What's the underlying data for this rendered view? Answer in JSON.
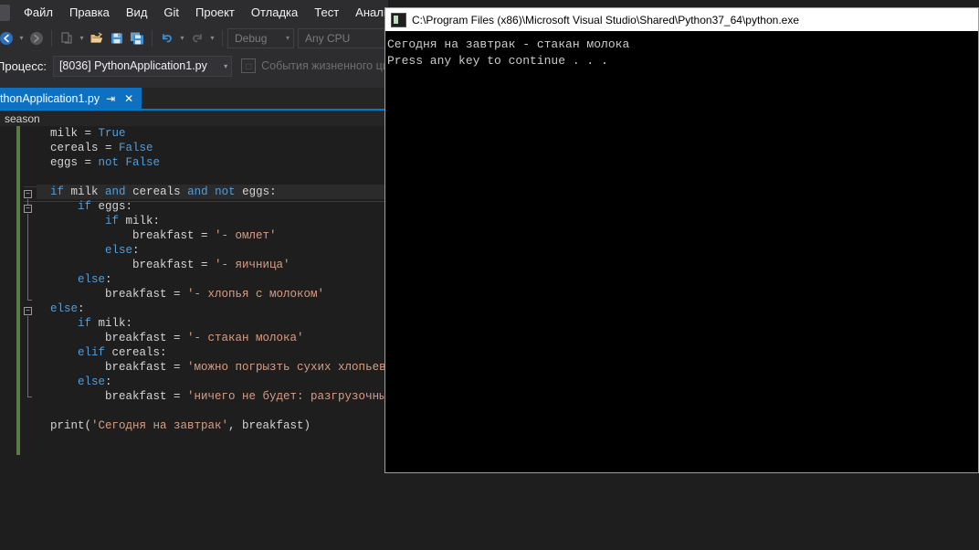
{
  "ide": {
    "menu": [
      {
        "label": "Файл"
      },
      {
        "label": "Правка"
      },
      {
        "label": "Вид"
      },
      {
        "label": "Git"
      },
      {
        "label": "Проект"
      },
      {
        "label": "Отладка"
      },
      {
        "label": "Тест"
      },
      {
        "label": "Анализ"
      }
    ],
    "toolbar": {
      "nav_back_icon": "arrow-left-circle-icon",
      "nav_forward_icon": "arrow-right-circle-icon",
      "new_item_icon": "new-item-icon",
      "open_file_icon": "open-folder-icon",
      "save_icon": "save-icon",
      "save_all_icon": "save-all-icon",
      "undo_icon": "undo-icon",
      "redo_icon": "redo-icon",
      "config_value": "Debug",
      "platform_value": "Any CPU"
    },
    "debug_bar": {
      "process_label": "Процесс:",
      "process_value": "[8036] PythonApplication1.py",
      "lifecycle_label": "События жизненного ци",
      "lifecycle_icon": "lifecycle-events-icon"
    },
    "tab": {
      "label": "thonApplication1.py",
      "pin_icon": "pin-icon",
      "close_icon": "close-icon"
    },
    "breadcrumb": {
      "text": "season"
    },
    "accent_color": "#007acc",
    "tab_active_color": "#0e70c0",
    "change_bar_color": "#5a7b45"
  },
  "code": {
    "lines": [
      [
        {
          "t": "  milk ",
          "c": "pl"
        },
        {
          "t": "= ",
          "c": "pl"
        },
        {
          "t": "True",
          "c": "kw"
        }
      ],
      [
        {
          "t": "  cereals ",
          "c": "pl"
        },
        {
          "t": "= ",
          "c": "pl"
        },
        {
          "t": "False",
          "c": "kw"
        }
      ],
      [
        {
          "t": "  eggs ",
          "c": "pl"
        },
        {
          "t": "= ",
          "c": "pl"
        },
        {
          "t": "not ",
          "c": "kw"
        },
        {
          "t": "False",
          "c": "kw"
        }
      ],
      [
        {
          "t": "",
          "c": "pl"
        }
      ],
      [
        {
          "t": "  ",
          "c": "pl"
        },
        {
          "t": "if ",
          "c": "kw"
        },
        {
          "t": "milk ",
          "c": "pl"
        },
        {
          "t": "and ",
          "c": "kw"
        },
        {
          "t": "cereals ",
          "c": "pl"
        },
        {
          "t": "and ",
          "c": "kw"
        },
        {
          "t": "not ",
          "c": "kw"
        },
        {
          "t": "eggs:",
          "c": "pl"
        }
      ],
      [
        {
          "t": "      ",
          "c": "pl"
        },
        {
          "t": "if ",
          "c": "kw"
        },
        {
          "t": "eggs:",
          "c": "pl"
        }
      ],
      [
        {
          "t": "          ",
          "c": "pl"
        },
        {
          "t": "if ",
          "c": "kw"
        },
        {
          "t": "milk:",
          "c": "pl"
        }
      ],
      [
        {
          "t": "              breakfast = ",
          "c": "pl"
        },
        {
          "t": "'- омлет'",
          "c": "st"
        }
      ],
      [
        {
          "t": "          ",
          "c": "pl"
        },
        {
          "t": "else",
          "c": "kw"
        },
        {
          "t": ":",
          "c": "pl"
        }
      ],
      [
        {
          "t": "              breakfast = ",
          "c": "pl"
        },
        {
          "t": "'- яичница'",
          "c": "st"
        }
      ],
      [
        {
          "t": "      ",
          "c": "pl"
        },
        {
          "t": "else",
          "c": "kw"
        },
        {
          "t": ":",
          "c": "pl"
        }
      ],
      [
        {
          "t": "          breakfast = ",
          "c": "pl"
        },
        {
          "t": "'- хлопья с молоком'",
          "c": "st"
        }
      ],
      [
        {
          "t": "  ",
          "c": "pl"
        },
        {
          "t": "else",
          "c": "kw"
        },
        {
          "t": ":",
          "c": "pl"
        }
      ],
      [
        {
          "t": "      ",
          "c": "pl"
        },
        {
          "t": "if ",
          "c": "kw"
        },
        {
          "t": "milk:",
          "c": "pl"
        }
      ],
      [
        {
          "t": "          breakfast = ",
          "c": "pl"
        },
        {
          "t": "'- стакан молока'",
          "c": "st"
        }
      ],
      [
        {
          "t": "      ",
          "c": "pl"
        },
        {
          "t": "elif ",
          "c": "kw"
        },
        {
          "t": "cereals:",
          "c": "pl"
        }
      ],
      [
        {
          "t": "          breakfast = ",
          "c": "pl"
        },
        {
          "t": "'можно погрызть сухих хлопьев'",
          "c": "st"
        }
      ],
      [
        {
          "t": "      ",
          "c": "pl"
        },
        {
          "t": "else",
          "c": "kw"
        },
        {
          "t": ":",
          "c": "pl"
        }
      ],
      [
        {
          "t": "          breakfast = ",
          "c": "pl"
        },
        {
          "t": "'ничего не будет: разгрузочный день",
          "c": "st"
        }
      ],
      [
        {
          "t": "",
          "c": "pl"
        }
      ],
      [
        {
          "t": "  print(",
          "c": "pl"
        },
        {
          "t": "'Сегодня на завтрак'",
          "c": "st"
        },
        {
          "t": ", breakfast)",
          "c": "pl"
        }
      ]
    ],
    "keyword_color": "#569cd6",
    "string_color": "#d69d85",
    "text_color": "#d4d4d4",
    "background": "#1e1e1e"
  },
  "console": {
    "title": "C:\\Program Files (x86)\\Microsoft Visual Studio\\Shared\\Python37_64\\python.exe",
    "icon": "console-app-icon",
    "output": [
      "Сегодня на завтрак - стакан молока",
      "Press any key to continue . . ."
    ],
    "background": "#000000",
    "text_color": "#cccccc"
  }
}
